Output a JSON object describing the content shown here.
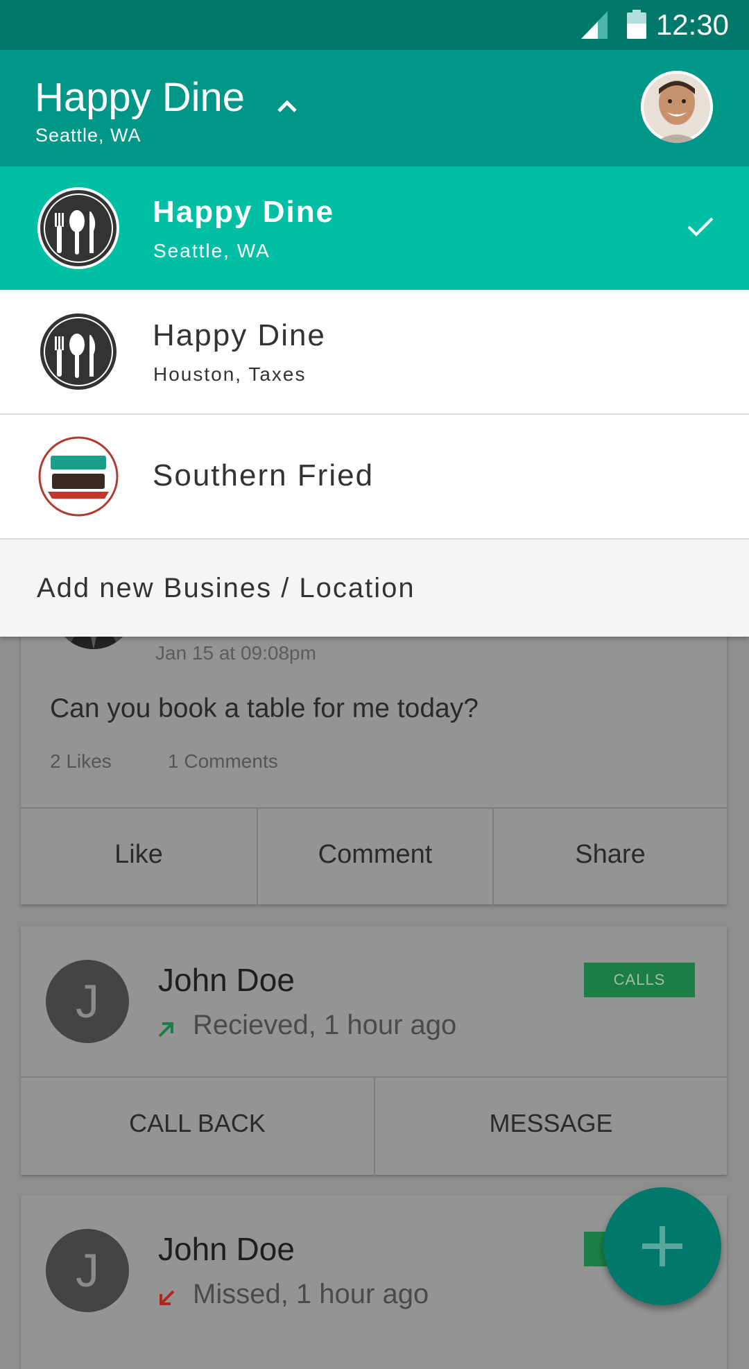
{
  "status_bar": {
    "time": "12:30"
  },
  "app_bar": {
    "title": "Happy Dine",
    "subtitle": "Seattle, WA"
  },
  "locations": [
    {
      "name": "Happy Dine",
      "city": "Seattle, WA",
      "selected": true
    },
    {
      "name": "Happy Dine",
      "city": "Houston, Taxes",
      "selected": false
    },
    {
      "name": "Southern Fried",
      "city": "",
      "selected": false
    }
  ],
  "add_new_label": "Add new Busines / Location",
  "post": {
    "time": "Jan 15 at 09:08pm",
    "text": "Can you book a table for me today?",
    "likes": "2 Likes",
    "comments": "1 Comments",
    "actions": [
      "Like",
      "Comment",
      "Share"
    ]
  },
  "calls": [
    {
      "avatar_letter": "J",
      "name": "John Doe",
      "status": "Recieved, 1 hour ago",
      "badge": "CALLS",
      "actions": [
        "CALL BACK",
        "MESSAGE"
      ]
    },
    {
      "avatar_letter": "J",
      "name": "John Doe",
      "status": "Missed, 1 hour ago",
      "badge": "CALLS"
    }
  ],
  "colors": {
    "status_bar": "#00796b",
    "app_bar": "#009688",
    "selected_item": "#00bfa5",
    "badge_green": "#1b7f45",
    "fab": "#00796b"
  }
}
